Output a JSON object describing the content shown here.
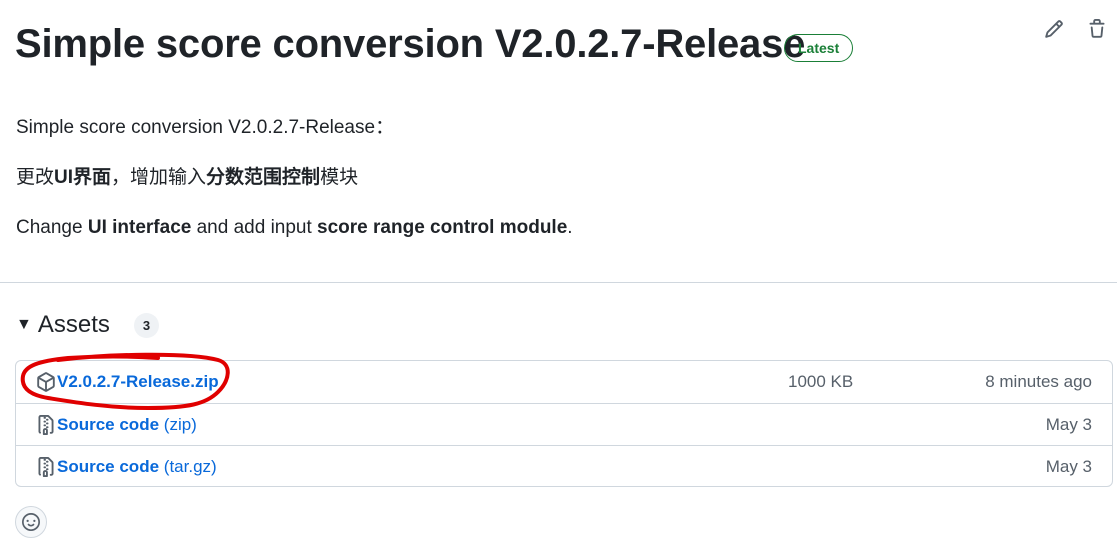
{
  "release": {
    "title": "Simple score conversion V2.0.2.7-Release",
    "badge": "Latest"
  },
  "actions": {
    "edit_icon": "pencil-icon",
    "delete_icon": "trash-icon"
  },
  "description": {
    "line1": "Simple score conversion V2.0.2.7-Release：",
    "line2": {
      "part1": "更改",
      "part2_bold": "UI界面",
      "part3": "，增加输入",
      "part4_bold": "分数范围控制",
      "part5": "模块"
    },
    "line3": {
      "part1": "Change ",
      "part2_bold": "UI interface",
      "part3": " and add input ",
      "part4_bold": "score range control module",
      "part5": "."
    }
  },
  "assets": {
    "label": "Assets",
    "count": "3",
    "items": [
      {
        "name": "V2.0.2.7-Release.zip",
        "format": "",
        "size": "1000 KB",
        "time": "8 minutes ago",
        "icon": "package-icon"
      },
      {
        "name": "Source code",
        "format": "(zip)",
        "size": "",
        "time": "May 3",
        "icon": "file-zip-icon"
      },
      {
        "name": "Source code",
        "format": "(tar.gz)",
        "size": "",
        "time": "May 3",
        "icon": "file-zip-icon"
      }
    ]
  },
  "annotation": {
    "color": "#e00000"
  },
  "reaction": {
    "icon": "smiley-icon"
  },
  "colors": {
    "link": "#0969da",
    "latest_green": "#1a7f37",
    "border": "#d0d7de",
    "muted": "#57606a"
  }
}
